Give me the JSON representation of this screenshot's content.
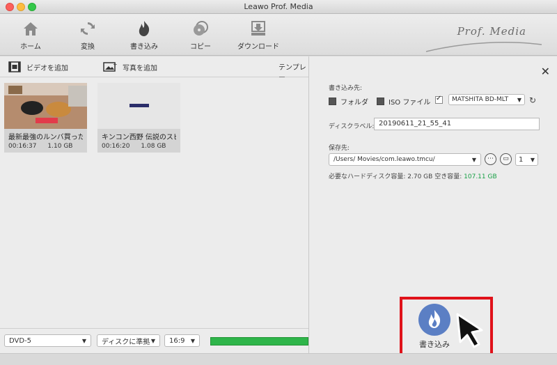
{
  "window": {
    "title": "Leawo Prof. Media"
  },
  "toolbar": {
    "items": [
      {
        "label": "ホーム",
        "icon": "home-icon"
      },
      {
        "label": "変換",
        "icon": "convert-icon"
      },
      {
        "label": "書き込み",
        "icon": "burn-icon"
      },
      {
        "label": "コピー",
        "icon": "copy-icon"
      },
      {
        "label": "ダウンロード",
        "icon": "download-icon"
      }
    ],
    "brand": "Prof. Media"
  },
  "subbar": {
    "add_video": "ビデオを追加",
    "add_photo": "写真を追加",
    "template": "テンプレー"
  },
  "media": [
    {
      "name": "最新最強のルンバ買った…",
      "duration": "00:16:37",
      "size": "1.10 GB"
    },
    {
      "name": "キンコン西野 伝説のスピ…",
      "duration": "00:16:20",
      "size": "1.08 GB"
    }
  ],
  "bottom": {
    "disc_type": "DVD-5",
    "fit_mode": "ディスクに準拠",
    "aspect": "16:9"
  },
  "burn_panel": {
    "target_label": "書き込み先:",
    "folder_label": "フォルダ",
    "iso_label": "ISO ファイル",
    "drive_value": "MATSHITA BD-MLT",
    "disc_label_label": "ディスクラベル:",
    "disc_label_value": "20190611_21_55_41",
    "save_to_label": "保存先:",
    "save_path": "/Users/        Movies/com.leawo.tmcu/",
    "copies": "1",
    "required_label": "必要なハードディスク容量:",
    "required_value": "2.70 GB",
    "free_label": "空き容量:",
    "free_value": "107.11 GB",
    "burn_button": "書き込み"
  },
  "colors": {
    "progress": "#2fb54a",
    "highlight": "#e0121a",
    "burn_circle": "#5b7fc4",
    "free_space": "#18a046"
  }
}
